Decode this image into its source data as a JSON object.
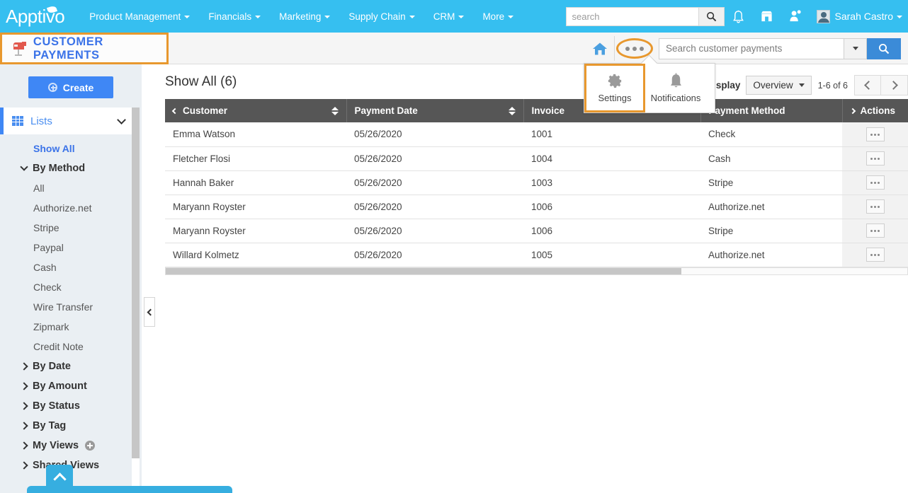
{
  "topnav": {
    "logo": "Apptivo",
    "menu": [
      {
        "label": "Product Management"
      },
      {
        "label": "Financials"
      },
      {
        "label": "Marketing"
      },
      {
        "label": "Supply Chain"
      },
      {
        "label": "CRM"
      },
      {
        "label": "More"
      }
    ],
    "search_placeholder": "search",
    "search_value": "",
    "user_name": "Sarah Castro",
    "icons": [
      "bell-icon",
      "store-icon",
      "user-plus-icon",
      "avatar"
    ],
    "bg_color": "#36bff0"
  },
  "subheader": {
    "page_title": "CUSTOMER PAYMENTS",
    "title_icon": "mailbox-icon",
    "highlight_color": "#e8982e",
    "title_color": "#3b73e8",
    "home_icon": "home-icon",
    "more_icon": "ellipsis-icon",
    "search_placeholder": "Search customer payments",
    "search_value": "",
    "search_button_color": "#3b8bd8"
  },
  "popup": {
    "items": [
      {
        "label": "Settings",
        "icon": "gear-icon",
        "selected": true
      },
      {
        "label": "Notifications",
        "icon": "bell-icon",
        "selected": false
      }
    ]
  },
  "sidebar": {
    "create_label": "Create",
    "lists_label": "Lists",
    "lists_icon": "grid-icon",
    "items": [
      {
        "label": "Show All",
        "type": "link"
      },
      {
        "label": "By Method",
        "type": "group-open"
      },
      {
        "label": "All",
        "type": "sub"
      },
      {
        "label": "Authorize.net",
        "type": "sub"
      },
      {
        "label": "Stripe",
        "type": "sub"
      },
      {
        "label": "Paypal",
        "type": "sub"
      },
      {
        "label": "Cash",
        "type": "sub"
      },
      {
        "label": "Check",
        "type": "sub"
      },
      {
        "label": "Wire Transfer",
        "type": "sub"
      },
      {
        "label": "Zipmark",
        "type": "sub"
      },
      {
        "label": "Credit Note",
        "type": "sub"
      },
      {
        "label": "By Date",
        "type": "group"
      },
      {
        "label": "By Amount",
        "type": "group"
      },
      {
        "label": "By Status",
        "type": "group"
      },
      {
        "label": "By Tag",
        "type": "group"
      },
      {
        "label": "My Views",
        "type": "group-add"
      },
      {
        "label": "Shared Views",
        "type": "group"
      }
    ],
    "collapse_icon": "chevron-left-icon",
    "scroll_top_icon": "chevron-up-icon"
  },
  "main": {
    "heading": "Show All (6)",
    "display_label": "Display",
    "display_value": "Overview",
    "page_range": "1-6 of 6",
    "prev_icon": "chevron-left-icon",
    "next_icon": "chevron-right-icon",
    "columns": [
      {
        "label": "Customer",
        "sortable": true,
        "lead": "chevron-left-icon"
      },
      {
        "label": "Payment Date",
        "sortable": true
      },
      {
        "label": "Invoice",
        "sortable": false
      },
      {
        "label": "Payment Method",
        "sortable": false
      },
      {
        "label": "Actions",
        "sortable": false,
        "lead": "chevron-right-icon"
      }
    ],
    "rows": [
      {
        "customer": "Emma Watson",
        "payment_date": "05/26/2020",
        "invoice": "1001",
        "payment_method": "Check"
      },
      {
        "customer": "Fletcher Flosi",
        "payment_date": "05/26/2020",
        "invoice": "1004",
        "payment_method": "Cash"
      },
      {
        "customer": "Hannah Baker",
        "payment_date": "05/26/2020",
        "invoice": "1003",
        "payment_method": "Stripe"
      },
      {
        "customer": "Maryann Royster",
        "payment_date": "05/26/2020",
        "invoice": "1006",
        "payment_method": "Authorize.net"
      },
      {
        "customer": "Maryann Royster",
        "payment_date": "05/26/2020",
        "invoice": "1006",
        "payment_method": "Stripe"
      },
      {
        "customer": "Willard Kolmetz",
        "payment_date": "05/26/2020",
        "invoice": "1005",
        "payment_method": "Authorize.net"
      }
    ],
    "row_action_icon": "ellipsis-icon"
  }
}
